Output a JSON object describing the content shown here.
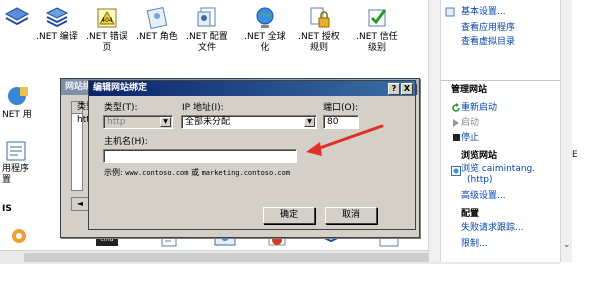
{
  "features": [
    {
      "label": ".NET 编译",
      "icon": "dotnet-compile-icon"
    },
    {
      "label": ".NET 错误页",
      "icon": "dotnet-error-pages-icon"
    },
    {
      "label": ".NET 角色",
      "icon": "dotnet-roles-icon"
    },
    {
      "label": ".NET 配置文件",
      "icon": "dotnet-profile-icon"
    },
    {
      "label": ".NET 全球化",
      "icon": "dotnet-globalization-icon"
    },
    {
      "label": ".NET 授权规则",
      "icon": "dotnet-authorization-icon"
    },
    {
      "label": ".NET 信任级别",
      "icon": "dotnet-trust-level-icon"
    }
  ],
  "left_strip": {
    "row1_label": "NET 用",
    "row2_label": "用程序\n置",
    "row3_label": "IS"
  },
  "bindings_dialog": {
    "title": "网站绑定",
    "list_header": "类型",
    "list_cell": "htt"
  },
  "edit_dialog": {
    "title": "编辑网站绑定",
    "type_label": "类型(T):",
    "type_value": "http",
    "ip_label": "IP 地址(I):",
    "ip_value": "全部未分配",
    "port_label": "端口(O):",
    "port_value": "80",
    "host_label": "主机名(H):",
    "host_value": "",
    "example_prefix": "示例:",
    "example_host1": "www.contoso.com",
    "example_or": "或",
    "example_host2": "marketing.contoso.com",
    "ok_label": "确定",
    "cancel_label": "取消",
    "help_btn": "?",
    "close_btn": "X"
  },
  "actions": {
    "basic_settings": "基本设置...",
    "view_apps": "查看应用程序",
    "view_vdirs": "查看虚拟目录",
    "manage_site_heading": "管理网站",
    "restart": "重新启动",
    "start": "启动",
    "stop": "停止",
    "browse_heading": "浏览网站",
    "browse_line1": "浏览 caimintang.",
    "browse_line2": "(http)",
    "advanced_settings": "高级设置...",
    "configure_heading": "配置",
    "failed_request_tracing": "失败请求跟踪...",
    "limits": "限制...",
    "cutoff_text": "E"
  },
  "colors": {
    "dialog_face": "#d4d0c8",
    "active_title": "#0a246a",
    "inactive_title": "#7b8ea8",
    "link": "#0645ad",
    "annotation": "#e0302a"
  }
}
